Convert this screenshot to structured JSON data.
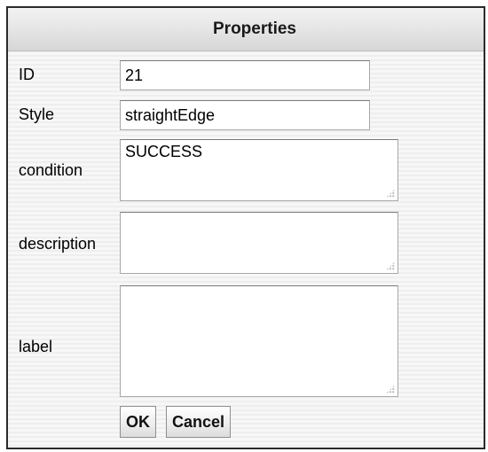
{
  "dialog": {
    "title": "Properties"
  },
  "fields": {
    "id": {
      "label": "ID",
      "value": "21"
    },
    "style": {
      "label": "Style",
      "value": "straightEdge"
    },
    "condition": {
      "label": "condition",
      "value": "SUCCESS"
    },
    "description": {
      "label": "description",
      "value": ""
    },
    "label": {
      "label": "label",
      "value": ""
    }
  },
  "buttons": {
    "ok": "OK",
    "cancel": "Cancel"
  }
}
